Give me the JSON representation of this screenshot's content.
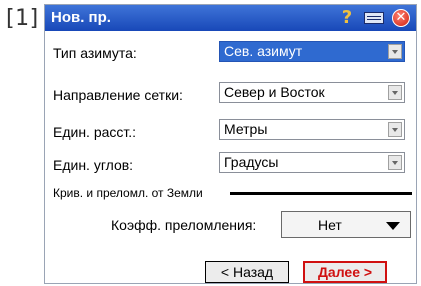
{
  "reference_marker": "[1]",
  "window": {
    "title": "Нов. пр."
  },
  "fields": [
    {
      "label": "Тип азимута:",
      "value": "Сев. азимут"
    },
    {
      "label": "Направление сетки:",
      "value": "Север и Восток"
    },
    {
      "label": "Един. расст.:",
      "value": "Метры"
    },
    {
      "label": "Един. углов:",
      "value": "Градусы"
    }
  ],
  "curvature_section": {
    "title": "Крив. и преломл. от Земли",
    "refraction_label": "Коэфф. преломления:",
    "refraction_value": "Нет"
  },
  "buttons": {
    "back": "< Назад",
    "next": "Далее >"
  },
  "colors": {
    "titlebar": "#1848b8",
    "selected_field": "#2f6ad0",
    "next_button": "#d01010"
  }
}
